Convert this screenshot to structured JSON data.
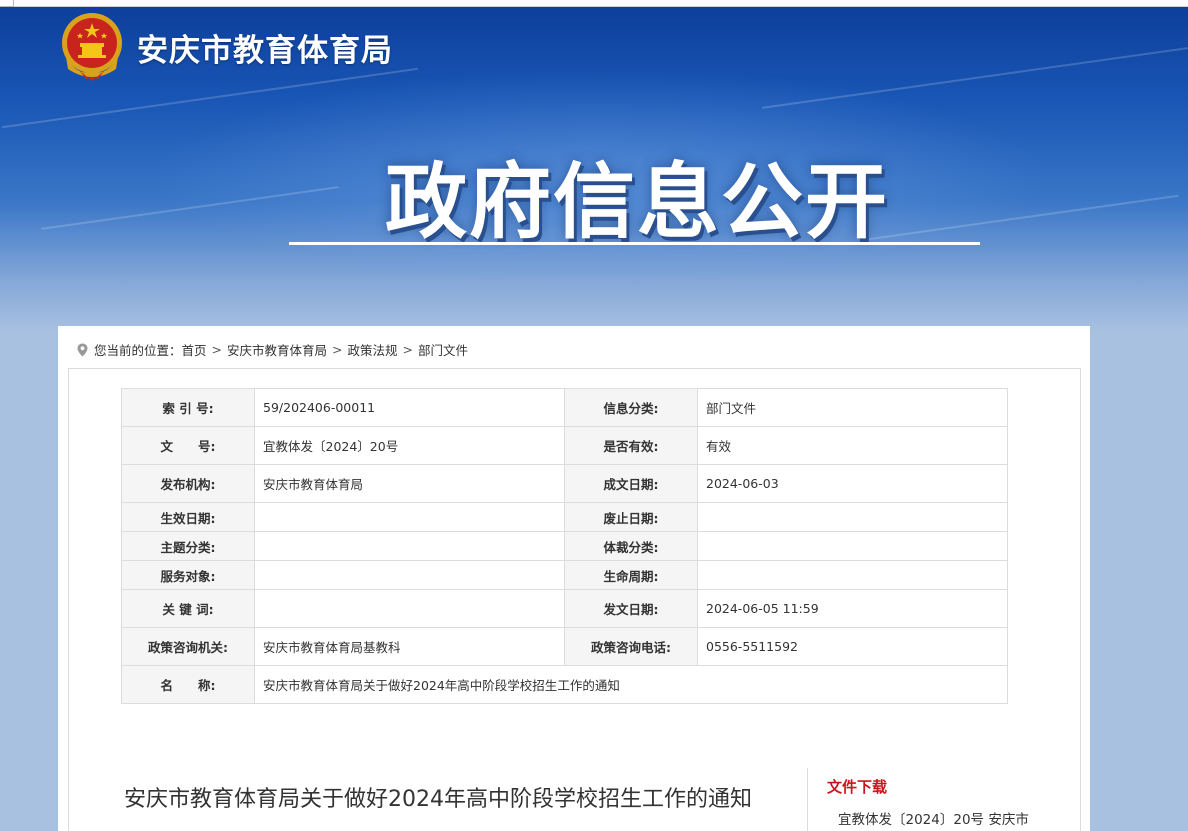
{
  "header": {
    "site_name": "安庆市教育体育局",
    "hero_title": "政府信息公开"
  },
  "breadcrumb": {
    "prefix": "您当前的位置：",
    "items": [
      "首页",
      "安庆市教育体育局",
      "政策法规",
      "部门文件"
    ],
    "separator": ">"
  },
  "meta": {
    "rows": [
      {
        "k1": "索 引 号:",
        "v1": "59/202406-00011",
        "k2": "信息分类:",
        "v2": "部门文件"
      },
      {
        "k1": "文　　号:",
        "v1": "宜教体发〔2024〕20号",
        "k2": "是否有效:",
        "v2": "有效"
      },
      {
        "k1": "发布机构:",
        "v1": "安庆市教育体育局",
        "k2": "成文日期:",
        "v2": "2024-06-03"
      },
      {
        "k1": "生效日期:",
        "v1": "",
        "k2": "废止日期:",
        "v2": ""
      },
      {
        "k1": "主题分类:",
        "v1": "",
        "k2": "体裁分类:",
        "v2": ""
      },
      {
        "k1": "服务对象:",
        "v1": "",
        "k2": "生命周期:",
        "v2": ""
      },
      {
        "k1": "关 键 词:",
        "v1": "",
        "k2": "发文日期:",
        "v2": "2024-06-05 11:59"
      },
      {
        "k1": "政策咨询机关:",
        "v1": "安庆市教育体育局基教科",
        "k2": "政策咨询电话:",
        "v2": "0556-5511592"
      }
    ],
    "name_label": "名　　称:",
    "name_value": "安庆市教育体育局关于做好2024年高中阶段学校招生工作的通知"
  },
  "document": {
    "title": "安庆市教育体育局关于做好2024年高中阶段学校招生工作的通知"
  },
  "download": {
    "heading": "文件下载",
    "item": "宜教体发〔2024〕20号 安庆市"
  },
  "colors": {
    "banner_dark": "#0d3f9c",
    "page_bg": "#a9c1e1",
    "download_heading": "#c8161d"
  }
}
